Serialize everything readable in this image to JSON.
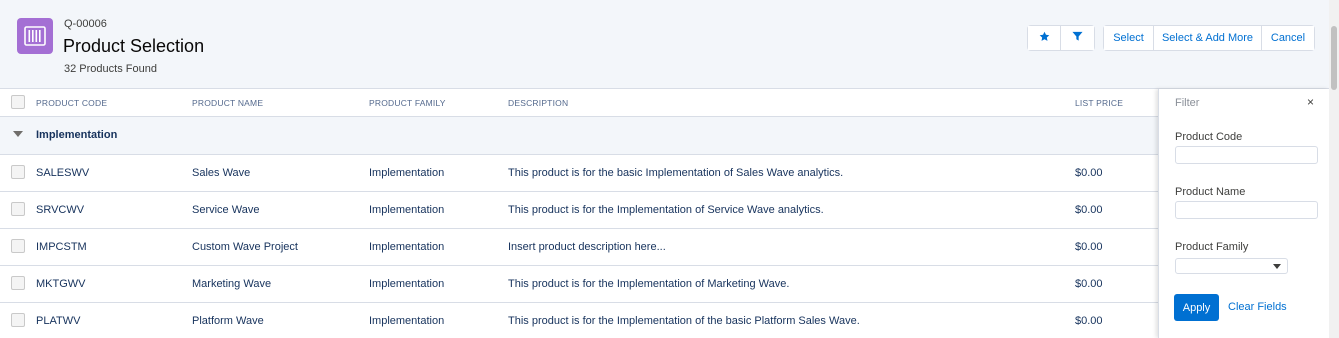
{
  "header": {
    "quote_id": "Q-00006",
    "title": "Product Selection",
    "subtitle": "32 Products Found",
    "icon": "product-bundle-icon",
    "icon_color": "#a46fd4"
  },
  "toolbar": {
    "favorite_icon": "star-icon",
    "filter_icon": "filter-icon",
    "select_label": "Select",
    "select_more_label": "Select & Add More",
    "cancel_label": "Cancel"
  },
  "table": {
    "columns": [
      "PRODUCT CODE",
      "PRODUCT NAME",
      "PRODUCT FAMILY",
      "DESCRIPTION",
      "LIST PRICE"
    ],
    "group": "Implementation",
    "rows": [
      {
        "code": "SALESWV",
        "name": "Sales Wave",
        "family": "Implementation",
        "description": "This product is for the basic Implementation of Sales Wave analytics.",
        "price": "$0.00"
      },
      {
        "code": "SRVCWV",
        "name": "Service Wave",
        "family": "Implementation",
        "description": "This product is for the Implementation of Service Wave analytics.",
        "price": "$0.00"
      },
      {
        "code": "IMPCSTM",
        "name": "Custom Wave Project",
        "family": "Implementation",
        "description": "Insert product description here...",
        "price": "$0.00"
      },
      {
        "code": "MKTGWV",
        "name": "Marketing Wave",
        "family": "Implementation",
        "description": "This product is for the Implementation of Marketing Wave.",
        "price": "$0.00"
      },
      {
        "code": "PLATWV",
        "name": "Platform Wave",
        "family": "Implementation",
        "description": "This product is for the Implementation of the basic Platform Sales Wave.",
        "price": "$0.00"
      }
    ]
  },
  "filter": {
    "title": "Filter",
    "close": "×",
    "product_code_label": "Product Code",
    "product_code_value": "",
    "product_name_label": "Product Name",
    "product_name_value": "",
    "product_family_label": "Product Family",
    "product_family_value": "",
    "apply_label": "Apply",
    "clear_label": "Clear Fields"
  },
  "colors": {
    "accent": "#0070d2",
    "header_bg": "#f3f6fa"
  }
}
